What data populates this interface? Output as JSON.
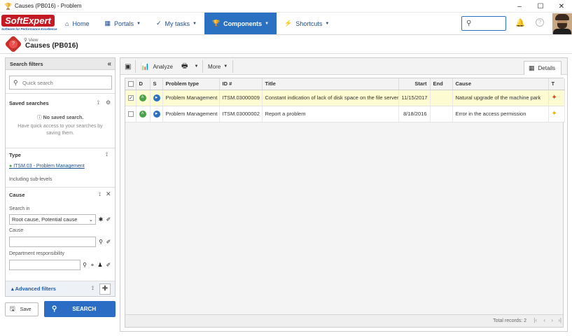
{
  "window": {
    "title": "Causes (PB016) - Problem",
    "icon": "trophy-icon",
    "controls": [
      "–",
      "☐",
      "✕"
    ]
  },
  "brand": {
    "name": "SoftExpert",
    "tagline": "Software for Performance Excellence"
  },
  "nav": {
    "items": [
      {
        "label": "Home",
        "icon": "home-icon"
      },
      {
        "label": "Portals",
        "icon": "portals-icon"
      },
      {
        "label": "My tasks",
        "icon": "check-icon"
      },
      {
        "label": "Components",
        "icon": "trophy-icon"
      },
      {
        "label": "Shortcuts",
        "icon": "bolt-icon"
      }
    ],
    "active": "Components",
    "accent": "#2b71c2"
  },
  "page": {
    "view_label": "View",
    "title": "Causes (PB016)"
  },
  "filters": {
    "header": "Search filters",
    "quick_search_placeholder": "Quick search",
    "saved_searches": {
      "title": "Saved searches",
      "empty_title": "No saved search.",
      "empty_hint": "Have quick access to your searches by saving them."
    },
    "type": {
      "title": "Type",
      "value": "ITSM.03 - Problem Management",
      "sublevels": "Including sub-levels"
    },
    "cause": {
      "title": "Cause",
      "search_in_label": "Search in",
      "search_in_value": "Root cause, Potential cause",
      "cause_label": "Cause",
      "department_label": "Department responsibility"
    },
    "advanced": "Advanced filters"
  },
  "buttons": {
    "save": "Save",
    "search": "SEARCH"
  },
  "toolbar": {
    "analyze": "Analyze",
    "more": "More",
    "details": "Details"
  },
  "grid": {
    "columns": [
      "",
      "D",
      "S",
      "Problem type",
      "ID #",
      "Title",
      "Start",
      "End",
      "Cause",
      "T"
    ],
    "rows": [
      {
        "selected": true,
        "problem_type": "Problem Management",
        "id": "ITSM.03000009",
        "title": "Constant indication of lack of disk space on the file server",
        "start": "11/15/2017",
        "end": "",
        "cause": "Natural upgrade of the machine park"
      },
      {
        "selected": false,
        "problem_type": "Problem Management",
        "id": "ITSM.03000002",
        "title": "Report a problem",
        "start": "8/18/2016",
        "end": "",
        "cause": "Error in the access permission"
      }
    ],
    "total_records": "Total records: 2"
  }
}
